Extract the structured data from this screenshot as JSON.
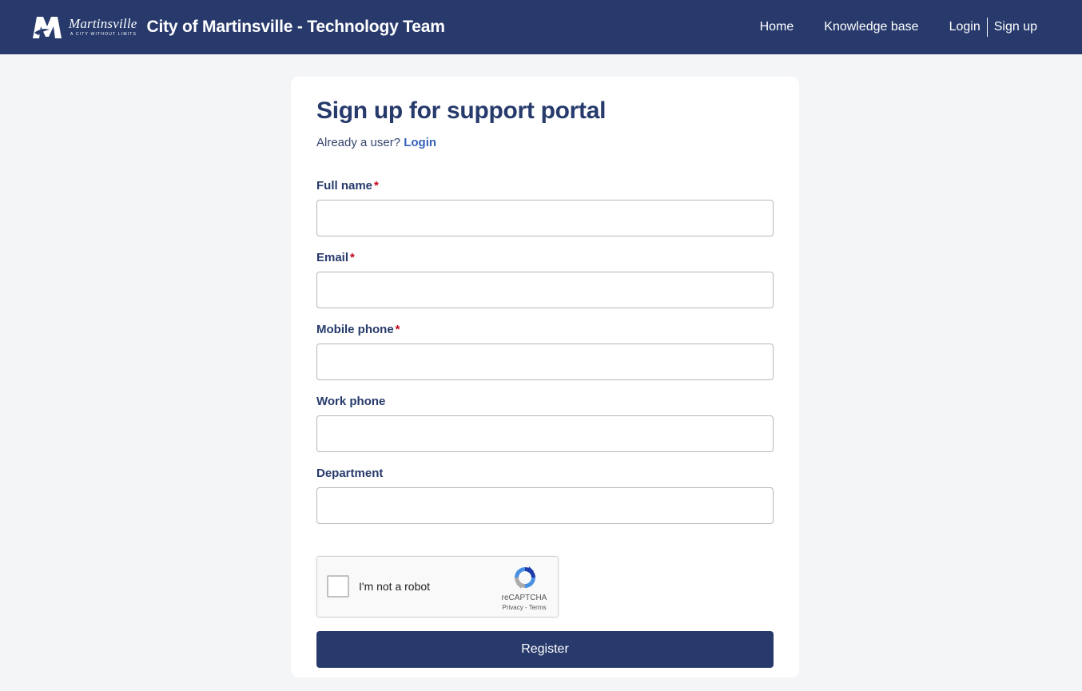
{
  "header": {
    "logo_name": "Martinsville",
    "logo_tagline": "A CITY WITHOUT LIMITS",
    "site_title": "City of Martinsville - Technology Team",
    "nav": {
      "home": "Home",
      "knowledge_base": "Knowledge base",
      "login": "Login",
      "signup": "Sign up"
    }
  },
  "form": {
    "title": "Sign up for support portal",
    "already_user": "Already a user?",
    "login_link": "Login",
    "required_mark": "*",
    "fields": [
      {
        "label": "Full name",
        "required": true,
        "value": ""
      },
      {
        "label": "Email",
        "required": true,
        "value": ""
      },
      {
        "label": "Mobile phone",
        "required": true,
        "value": ""
      },
      {
        "label": "Work phone",
        "required": false,
        "value": ""
      },
      {
        "label": "Department",
        "required": false,
        "value": ""
      }
    ],
    "captcha": {
      "label": "I'm not a robot",
      "brand": "reCAPTCHA",
      "links": "Privacy - Terms"
    },
    "submit_label": "Register"
  },
  "colors": {
    "header_bg": "#283a6c",
    "accent": "#3561b8",
    "required": "#c4001d"
  }
}
